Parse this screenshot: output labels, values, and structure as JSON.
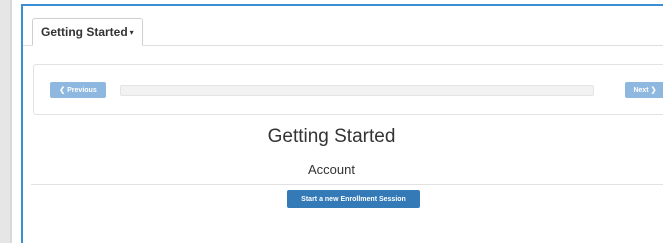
{
  "tab": {
    "label": "Getting Started",
    "caret": "▾"
  },
  "nav": {
    "previous_label": "Previous",
    "previous_glyph": "❮",
    "next_label": "Next",
    "next_glyph": "❯",
    "progress": 0
  },
  "content": {
    "title": "Getting Started",
    "subtitle": "Account",
    "start_button_label": "Start a new Enrollment Session"
  },
  "colors": {
    "frame_border": "#3b8fd2",
    "primary_button": "#337ab7",
    "nav_button": "#8fb8e0"
  }
}
